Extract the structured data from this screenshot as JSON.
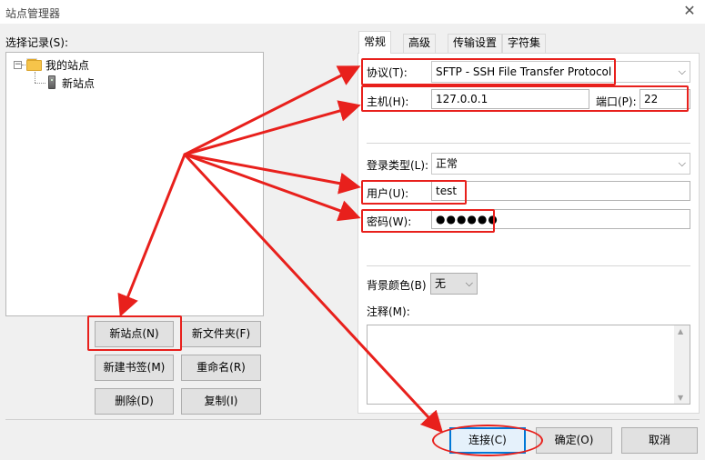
{
  "window": {
    "title": "站点管理器",
    "close_glyph": "✕"
  },
  "left": {
    "section_label": "选择记录(S):",
    "tree": {
      "toggle_glyph": "−",
      "root_label": "我的站点",
      "child_label": "新站点"
    }
  },
  "buttons": {
    "new_site": "新站点(N)",
    "new_folder": "新文件夹(F)",
    "new_bookmark": "新建书签(M)",
    "rename": "重命名(R)",
    "delete": "删除(D)",
    "copy": "复制(I)"
  },
  "tabs": [
    {
      "label": "常规",
      "active": true
    },
    {
      "label": "高级",
      "active": false
    },
    {
      "label": "传输设置",
      "active": false
    },
    {
      "label": "字符集",
      "active": false
    }
  ],
  "general": {
    "protocol_label": "协议(T):",
    "protocol_value": "SFTP - SSH File Transfer Protocol",
    "host_label": "主机(H):",
    "host_value": "127.0.0.1",
    "port_label": "端口(P):",
    "port_value": "22",
    "logon_type_label": "登录类型(L):",
    "logon_type_value": "正常",
    "user_label": "用户(U):",
    "user_value": "test",
    "password_label": "密码(W):",
    "password_value": "●●●●●●",
    "bg_color_label": "背景颜色(B)",
    "bg_color_value": "无",
    "comments_label": "注释(M):",
    "combo_arrow": "⌵"
  },
  "footer": {
    "connect": "连接(C)",
    "ok": "确定(O)",
    "cancel": "取消"
  },
  "colors": {
    "annotation_red": "#e8201c",
    "default_button_border": "#0078d7",
    "client_bg": "#f0f0f0"
  }
}
